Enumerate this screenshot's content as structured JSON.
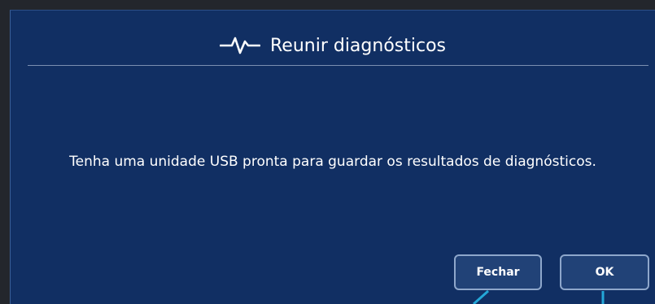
{
  "dialog": {
    "title": "Reunir diagnósticos",
    "title_icon": "pulse-icon",
    "message": "Tenha uma unidade USB pronta para guardar os resultados de diagnósticos.",
    "buttons": {
      "close_label": "Fechar",
      "ok_label": "OK"
    }
  },
  "colors": {
    "dialog_background": "#112f63",
    "text": "#ffffff",
    "button_border": "#8ea7cb",
    "callout_line": "#24a7d8"
  }
}
